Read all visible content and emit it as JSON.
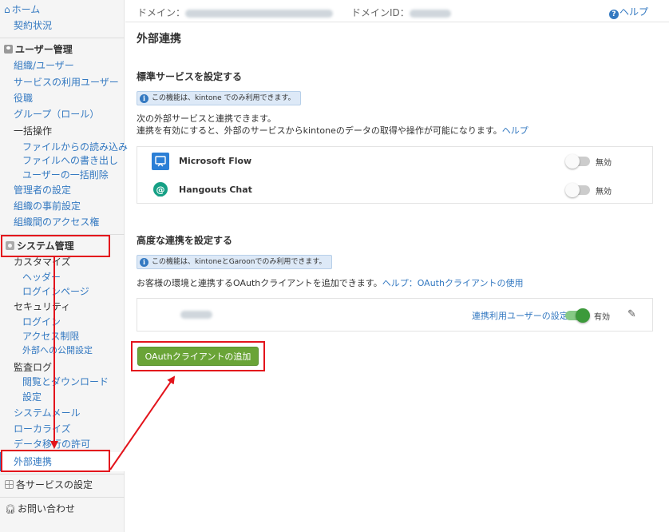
{
  "sidebar": {
    "home": "ホーム",
    "contract": "契約状況",
    "user_mgmt": "ユーザー管理",
    "org_users": "組織/ユーザー",
    "service_users": "サービスの利用ユーザー",
    "roles": "役職",
    "groups": "グループ（ロール）",
    "bulk_ops": "一括操作",
    "import_file": "ファイルからの読み込み",
    "export_file": "ファイルへの書き出し",
    "bulk_delete": "ユーザーの一括削除",
    "admin_settings": "管理者の設定",
    "org_presets": "組織の事前設定",
    "org_access": "組織間のアクセス権",
    "system_mgmt": "システム管理",
    "customize": "カスタマイズ",
    "header": "ヘッダー",
    "login_page": "ログインページ",
    "security": "セキュリティ",
    "login": "ログイン",
    "access_limit": "アクセス制限",
    "external_publish": "外部への公開設定",
    "audit_log": "監査ログ",
    "view_download": "閲覧とダウンロード",
    "settings": "設定",
    "system_mail": "システムメール",
    "localize": "ローカライズ",
    "data_migration": "データ移行の許可",
    "external_integration": "外部連携",
    "service_settings": "各サービスの設定",
    "contact": "お問い合わせ"
  },
  "topbar": {
    "domain_label": "ドメイン：",
    "domain_id_label": "ドメインID：",
    "help": "ヘルプ"
  },
  "main": {
    "title": "外部連携",
    "standard": {
      "title": "標準サービスを設定する",
      "badge": "この機能は、kintone でのみ利用できます。",
      "desc1": "次の外部サービスと連携できます。",
      "desc2": "連携を有効にすると、外部のサービスからkintoneのデータの取得や操作が可能になります。",
      "help_link": "ヘルプ",
      "services": [
        {
          "name": "Microsoft Flow",
          "status": "無効",
          "enabled": false
        },
        {
          "name": "Hangouts Chat",
          "status": "無効",
          "enabled": false
        }
      ]
    },
    "advanced": {
      "title": "高度な連携を設定する",
      "badge": "この機能は、kintoneとGaroonでのみ利用できます。",
      "desc": "お客様の環境と連携するOAuthクライアントを追加できます。",
      "help_link": "ヘルプ：OAuthクライアントの使用",
      "client": {
        "user_settings_link": "連携利用ユーザーの設定",
        "status": "有効",
        "enabled": true
      },
      "add_button": "OAuthクライアントの追加"
    }
  },
  "colors": {
    "link": "#3479c1",
    "annotation_red": "#e3141c",
    "button_green": "#6aa437"
  }
}
